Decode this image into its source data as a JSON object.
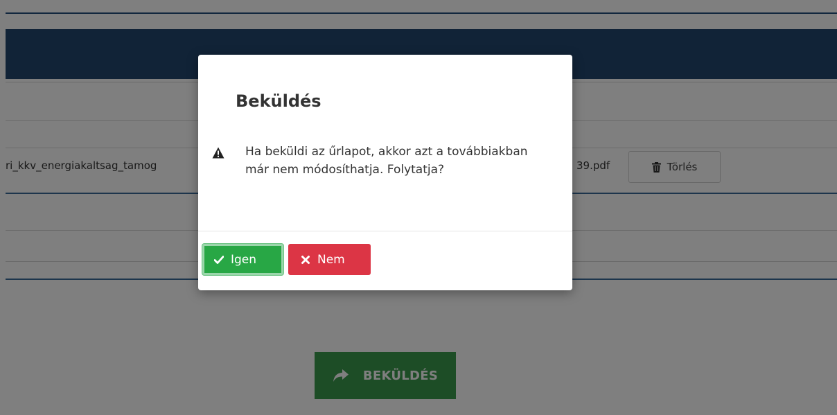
{
  "page": {
    "file_name_prefix": "ri_kkv_energiakaltsag_tamog",
    "file_name_suffix": "39.pdf",
    "delete_label": "Törlés",
    "send_label": "BEKÜLDÉS"
  },
  "modal": {
    "title": "Beküldés",
    "message": "Ha beküldi az űrlapot, akkor azt a továbbiakban már nem módosíthatja. Folytatja?",
    "yes_label": "Igen",
    "no_label": "Nem"
  },
  "colors": {
    "header": "#23466f",
    "yes": "#28a745",
    "no": "#dc3545",
    "send": "#3b9a4d"
  },
  "icons": {
    "delete": "trash-icon",
    "send": "share-arrow-icon",
    "warning": "warning-icon",
    "yes": "check-icon",
    "no": "times-icon"
  }
}
